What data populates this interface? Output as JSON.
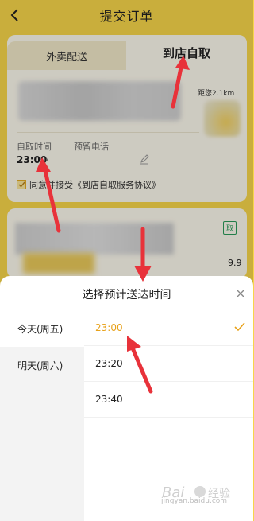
{
  "header": {
    "title": "提交订单"
  },
  "tabs": {
    "delivery": "外卖配送",
    "pickup": "到店自取"
  },
  "store": {
    "distance": "距您2.1km"
  },
  "pickup": {
    "time_label": "自取时间",
    "time_value": "23:00",
    "phone_label": "预留电话"
  },
  "agreement": {
    "text": "同意并接受《到店自取服务协议》"
  },
  "order_item": {
    "badge": "取",
    "price_fragment": "9.9"
  },
  "sheet": {
    "title": "选择预计送达时间",
    "days": [
      {
        "label": "今天(周五)",
        "active": true
      },
      {
        "label": "明天(周六)",
        "active": false
      }
    ],
    "times": [
      {
        "label": "23:00",
        "selected": true
      },
      {
        "label": "23:20",
        "selected": false
      },
      {
        "label": "23:40",
        "selected": false
      }
    ]
  },
  "watermark": {
    "text": "jingyan.baidu.com"
  },
  "colors": {
    "brand_yellow": "#f6d54a",
    "selected_orange": "#e8a21b",
    "annotation_red": "#e8323a"
  }
}
